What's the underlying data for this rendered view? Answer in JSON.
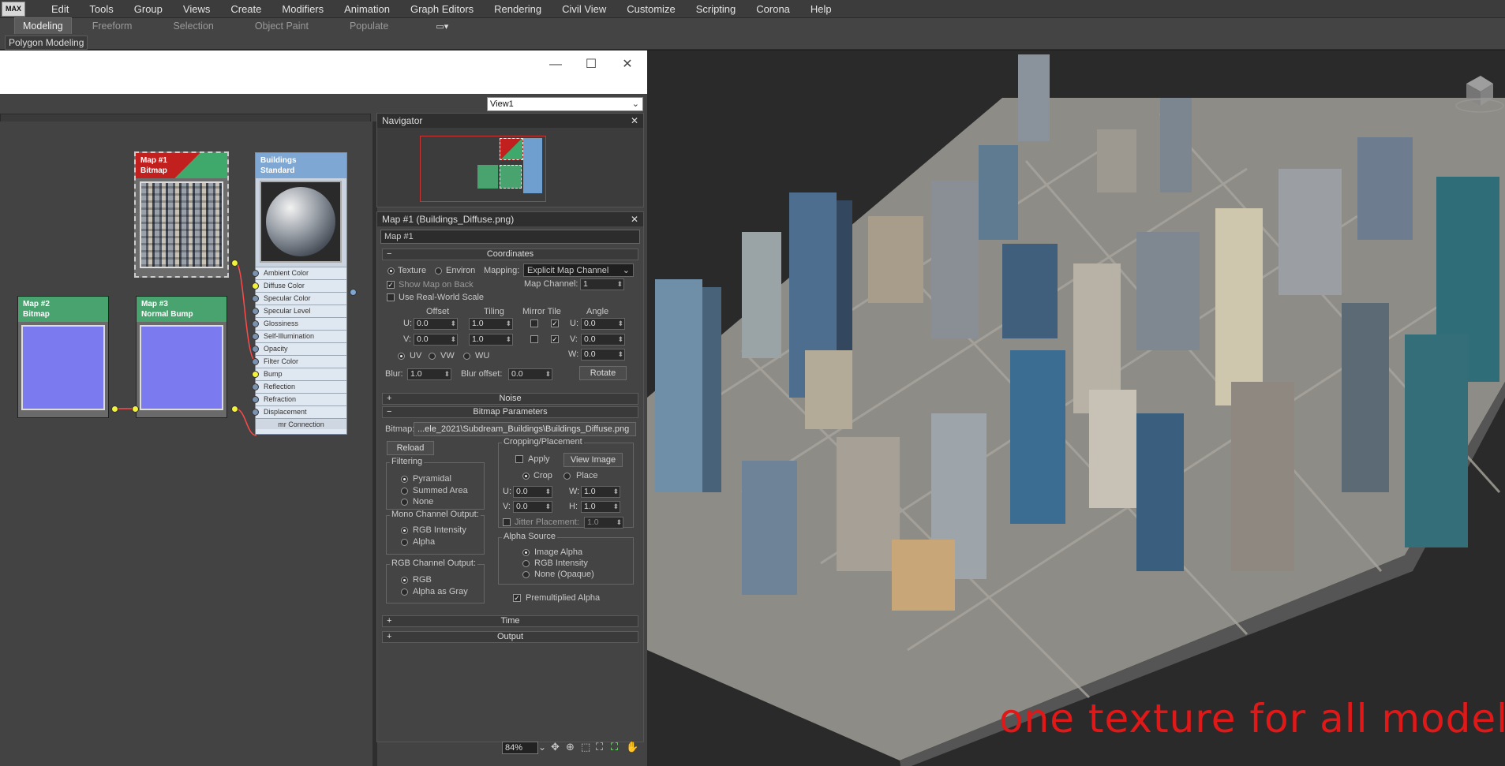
{
  "menubar": {
    "logo": "MAX",
    "items": [
      "Edit",
      "Tools",
      "Group",
      "Views",
      "Create",
      "Modifiers",
      "Animation",
      "Graph Editors",
      "Rendering",
      "Civil View",
      "Customize",
      "Scripting",
      "Corona",
      "Help"
    ]
  },
  "ribbon": {
    "tabs": [
      "Modeling",
      "Freeform",
      "Selection",
      "Object Paint",
      "Populate"
    ],
    "active": "Modeling",
    "sub_label": "Polygon Modeling"
  },
  "editor": {
    "view_select": "View1",
    "nodes": {
      "map1": {
        "title": "Map #1",
        "type": "Bitmap"
      },
      "material": {
        "title": "Buildings",
        "type": "Standard"
      },
      "map2": {
        "title": "Map #2",
        "type": "Bitmap"
      },
      "map3": {
        "title": "Map #3",
        "type": "Normal Bump"
      }
    },
    "slots": [
      "Ambient Color",
      "Diffuse Color",
      "Specular Color",
      "Specular Level",
      "Glossiness",
      "Self-Illumination",
      "Opacity",
      "Filter Color",
      "Bump",
      "Reflection",
      "Refraction",
      "Displacement"
    ],
    "slots_footer": "mr Connection",
    "navigator_title": "Navigator"
  },
  "params": {
    "title": "Map #1 (Buildings_Diffuse.png)",
    "name_field": "Map #1",
    "coordinates": {
      "header": "Coordinates",
      "texture": "Texture",
      "environ": "Environ",
      "mapping_label": "Mapping:",
      "mapping_value": "Explicit Map Channel",
      "show_map_on_back": "Show Map on Back",
      "map_channel_label": "Map Channel:",
      "map_channel": "1",
      "real_world": "Use Real-World Scale",
      "col_offset": "Offset",
      "col_tiling": "Tiling",
      "col_mirror": "Mirror Tile",
      "col_angle": "Angle",
      "u_label": "U:",
      "v_label": "V:",
      "w_label": "W:",
      "u_offset": "0.0",
      "v_offset": "0.0",
      "u_tiling": "1.0",
      "v_tiling": "1.0",
      "u_angle": "0.0",
      "v_angle": "0.0",
      "w_angle": "0.0",
      "uv": "UV",
      "vw": "VW",
      "wu": "WU",
      "blur_label": "Blur:",
      "blur": "1.0",
      "blur_offset_label": "Blur offset:",
      "blur_offset": "0.0",
      "rotate": "Rotate"
    },
    "noise_header": "Noise",
    "bitmap": {
      "header": "Bitmap Parameters",
      "bitmap_label": "Bitmap:",
      "path": "...ele_2021\\Subdream_Buildings\\Buildings_Diffuse.png",
      "reload": "Reload",
      "cropping": "Cropping/Placement",
      "apply": "Apply",
      "view_image": "View Image",
      "crop": "Crop",
      "place": "Place",
      "u_label": "U:",
      "v_label": "V:",
      "w_label": "W:",
      "h_label": "H:",
      "u": "0.0",
      "v": "0.0",
      "w": "1.0",
      "h": "1.0",
      "jitter": "Jitter Placement:",
      "jitter_val": "1.0",
      "filtering": "Filtering",
      "pyramidal": "Pyramidal",
      "summed": "Summed Area",
      "none": "None",
      "mono": "Mono Channel Output:",
      "rgb_intensity": "RGB Intensity",
      "alpha": "Alpha",
      "rgb_out": "RGB Channel Output:",
      "rgb": "RGB",
      "alpha_gray": "Alpha as Gray",
      "alpha_source": "Alpha Source",
      "image_alpha": "Image Alpha",
      "src_rgb_intensity": "RGB Intensity",
      "none_opaque": "None (Opaque)",
      "premult": "Premultiplied Alpha"
    },
    "time_header": "Time",
    "output_header": "Output"
  },
  "status": {
    "zoom": "84%"
  },
  "overlay": {
    "text": "one texture for all models",
    "color": "#e01818"
  }
}
